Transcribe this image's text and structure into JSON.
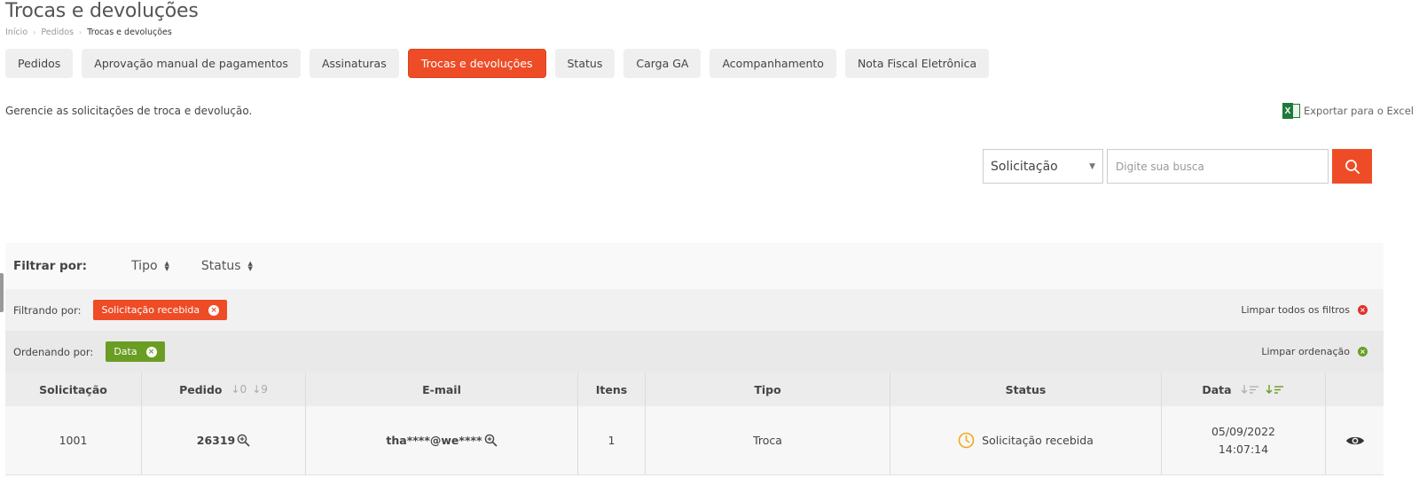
{
  "header": {
    "title": "Trocas e devoluções",
    "breadcrumb": [
      "Início",
      "Pedidos",
      "Trocas e devoluções"
    ]
  },
  "tabs": [
    {
      "label": "Pedidos",
      "active": false
    },
    {
      "label": "Aprovação manual de pagamentos",
      "active": false
    },
    {
      "label": "Assinaturas",
      "active": false
    },
    {
      "label": "Trocas e devoluções",
      "active": true
    },
    {
      "label": "Status",
      "active": false
    },
    {
      "label": "Carga GA",
      "active": false
    },
    {
      "label": "Acompanhamento",
      "active": false
    },
    {
      "label": "Nota Fiscal Eletrônica",
      "active": false
    }
  ],
  "description": "Gerencie as solicitações de troca e devolução.",
  "export_label": "Exportar para o Excel",
  "search": {
    "select_value": "Solicitação",
    "placeholder": "Digite sua busca"
  },
  "filter": {
    "label": "Filtrar por:",
    "dropdowns": [
      "Tipo",
      "Status"
    ]
  },
  "filtering": {
    "label": "Filtrando por:",
    "chip": "Solicitação recebida",
    "clear": "Limpar todos os filtros"
  },
  "ordering": {
    "label": "Ordenando por:",
    "chip": "Data",
    "clear": "Limpar ordenação"
  },
  "table": {
    "columns": [
      "Solicitação",
      "Pedido",
      "E-mail",
      "Itens",
      "Tipo",
      "Status",
      "Data",
      ""
    ],
    "pedido_sort": [
      "↓0",
      "↓9"
    ],
    "rows": [
      {
        "solicitacao": "1001",
        "pedido": "26319",
        "email": "tha****@we****",
        "itens": "1",
        "tipo": "Troca",
        "status": "Solicitação recebida",
        "date": "05/09/2022",
        "time": "14:07:14"
      }
    ]
  },
  "colors": {
    "accent": "#ee4c27",
    "green": "#6a9d24",
    "status_pending": "#f0a81e"
  }
}
